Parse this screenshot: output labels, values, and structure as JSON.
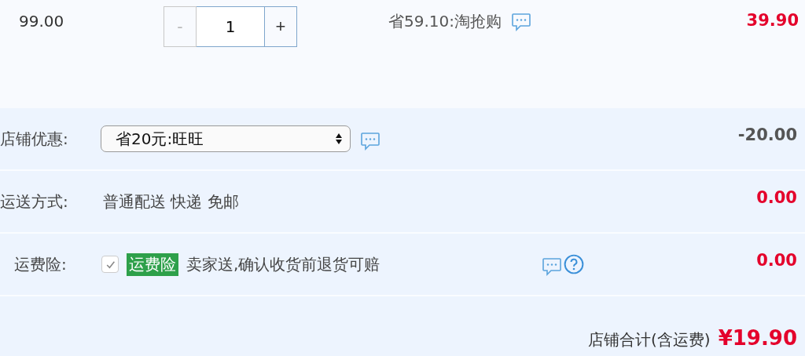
{
  "item": {
    "unit_price": "99.00",
    "quantity": {
      "decrement": "-",
      "decrement_disabled": true,
      "value": "1",
      "increment": "+"
    },
    "promotion": "省59.10:淘抢购",
    "subtotal": "39.90"
  },
  "rows": [
    {
      "kind": "select",
      "label": "店铺优惠:",
      "value": "省20元:旺旺",
      "amount": "-20.00",
      "color": "#555555"
    },
    {
      "kind": "text",
      "label": "运送方式:",
      "value": "普通配送 快递 免邮",
      "amount": "0.00",
      "color": "#e4002b"
    },
    {
      "kind": "insurance",
      "label": "运费险:",
      "checked": true,
      "badge": "运费险",
      "value": "卖家送,确认收货前退货可赔",
      "amount": "0.00",
      "color": "#e4002b"
    }
  ],
  "total": {
    "label": "店铺合计(含运费)",
    "amount": "¥19.90"
  }
}
